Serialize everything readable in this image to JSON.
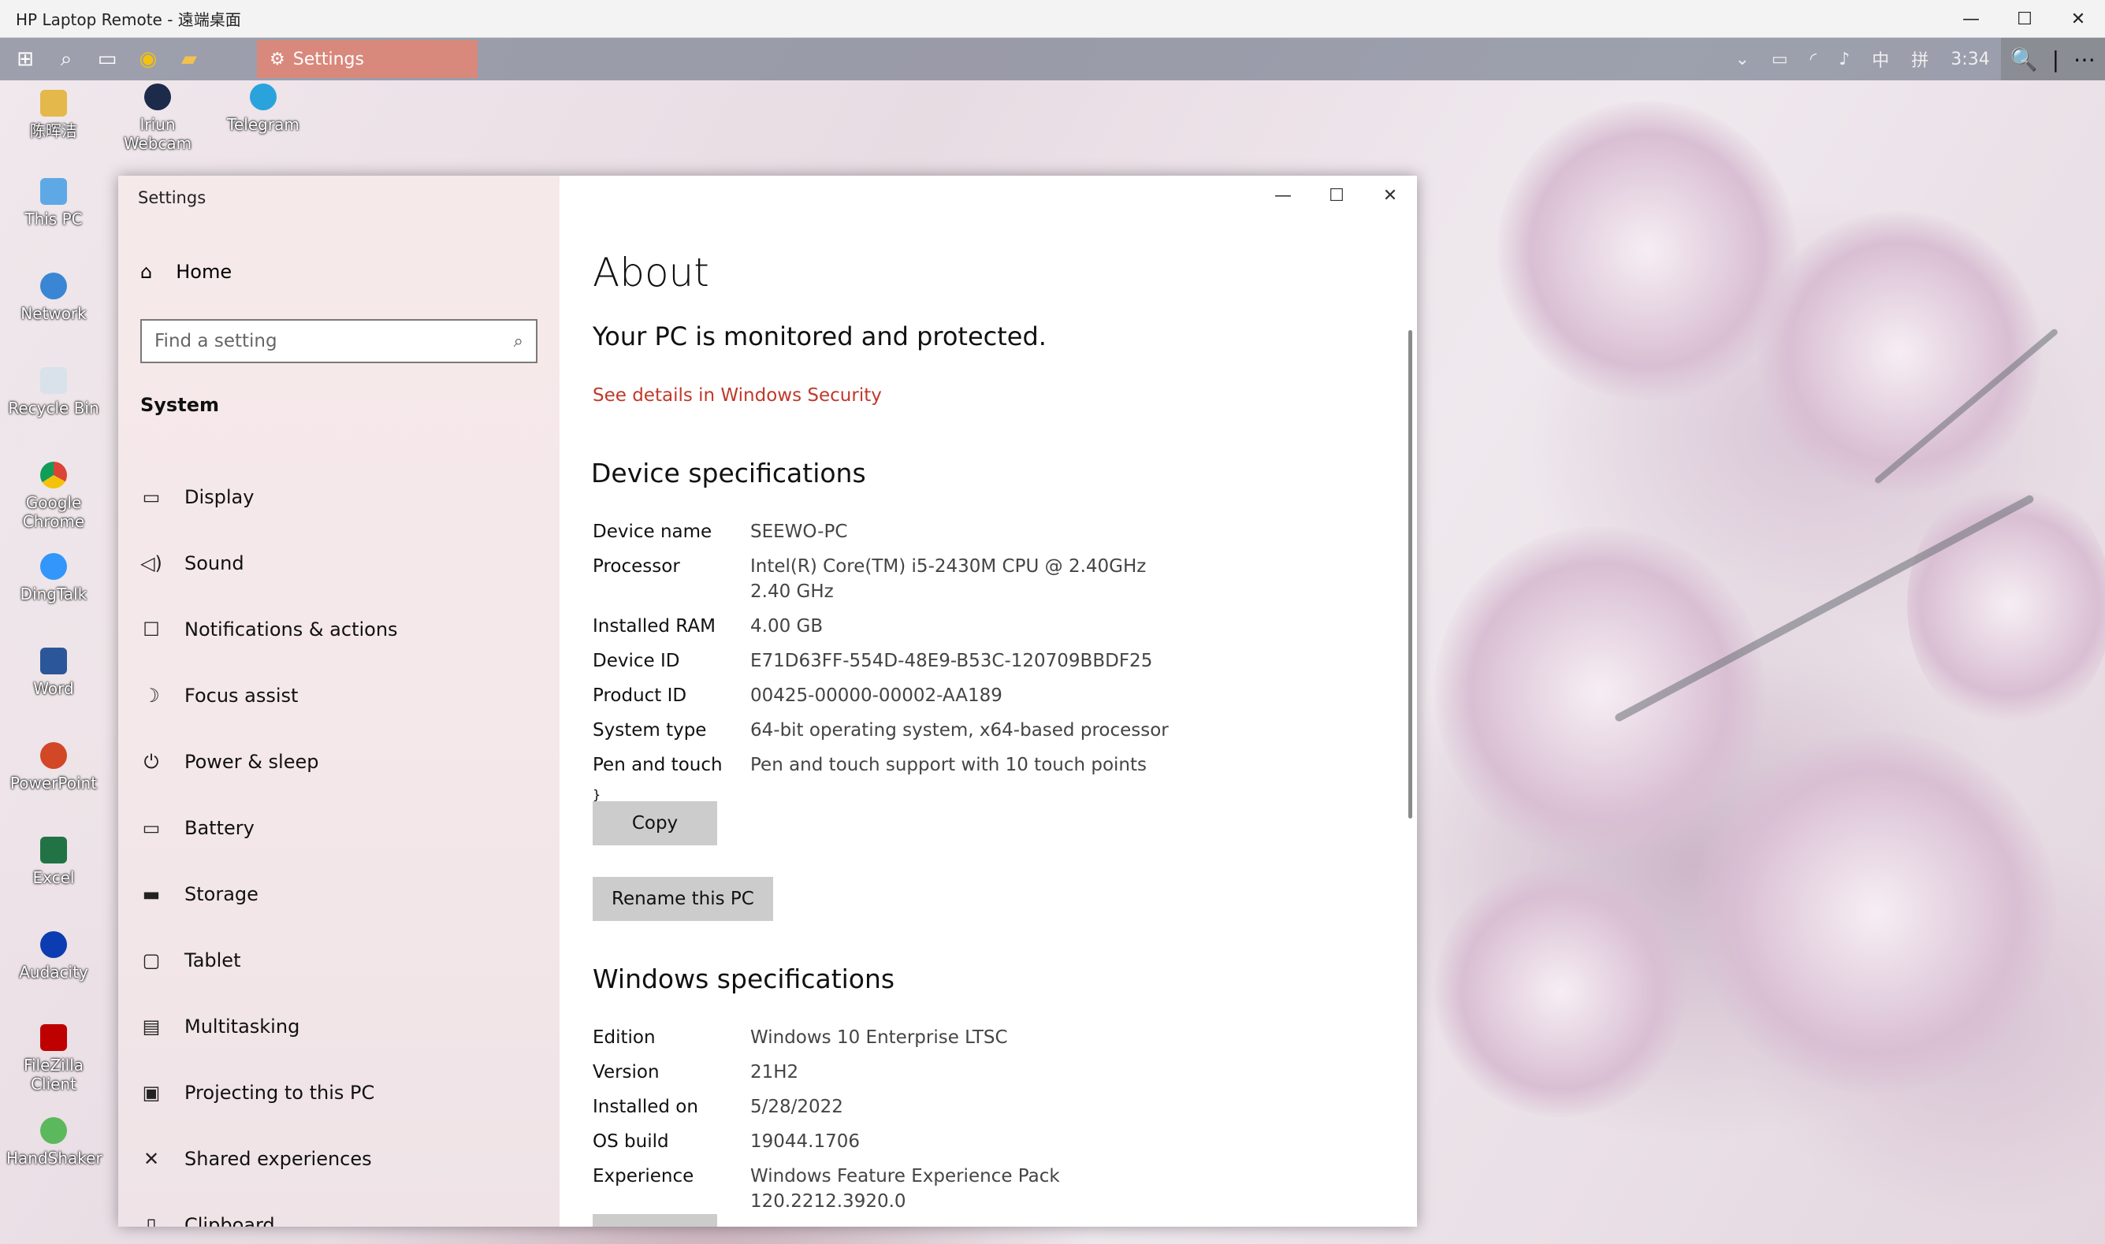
{
  "remote_window": {
    "title": "HP Laptop Remote - 遠端桌面",
    "minimize": "—",
    "maximize": "☐",
    "close": "✕"
  },
  "taskbar": {
    "settings_label": "Settings",
    "tray_ime": "中",
    "tray_ime2": "拼",
    "clock": "3:34",
    "zoom_icon": "🔍",
    "more": "⋯",
    "divider": "|"
  },
  "desktop_icons": [
    {
      "label": "陈晖洁"
    },
    {
      "label": "Iriun Webcam"
    },
    {
      "label": "Telegram"
    },
    {
      "label": "This PC"
    },
    {
      "label": "Network"
    },
    {
      "label": "Recycle Bin"
    },
    {
      "label": "Google Chrome"
    },
    {
      "label": "DingTalk"
    },
    {
      "label": "Word"
    },
    {
      "label": "PowerPoint"
    },
    {
      "label": "Excel"
    },
    {
      "label": "Audacity"
    },
    {
      "label": "FileZilla Client"
    },
    {
      "label": "HandShaker"
    }
  ],
  "settings": {
    "window_title": "Settings",
    "home_label": "Home",
    "search_placeholder": "Find a setting",
    "section_label": "System",
    "nav": [
      {
        "label": "Display",
        "icon": "display-icon"
      },
      {
        "label": "Sound",
        "icon": "sound-icon"
      },
      {
        "label": "Notifications & actions",
        "icon": "notifications-icon"
      },
      {
        "label": "Focus assist",
        "icon": "moon-icon"
      },
      {
        "label": "Power & sleep",
        "icon": "power-icon"
      },
      {
        "label": "Battery",
        "icon": "battery-icon"
      },
      {
        "label": "Storage",
        "icon": "storage-icon"
      },
      {
        "label": "Tablet",
        "icon": "tablet-icon"
      },
      {
        "label": "Multitasking",
        "icon": "multitasking-icon"
      },
      {
        "label": "Projecting to this PC",
        "icon": "projecting-icon"
      },
      {
        "label": "Shared experiences",
        "icon": "shared-icon"
      },
      {
        "label": "Clipboard",
        "icon": "clipboard-icon"
      }
    ],
    "about": {
      "title": "About",
      "protected": "Your PC is monitored and protected.",
      "security_link": "See details in Windows Security",
      "device_heading": "Device specifications",
      "device_specs": [
        {
          "key": "Device name",
          "value": "SEEWO-PC"
        },
        {
          "key": "Processor",
          "value": "Intel(R) Core(TM) i5-2430M CPU @ 2.40GHz   2.40 GHz"
        },
        {
          "key": "Installed RAM",
          "value": "4.00 GB"
        },
        {
          "key": "Device ID",
          "value": "E71D63FF-554D-48E9-B53C-120709BBDF25"
        },
        {
          "key": "Product ID",
          "value": "00425-00000-00002-AA189"
        },
        {
          "key": "System type",
          "value": "64-bit operating system, x64-based processor"
        },
        {
          "key": "Pen and touch",
          "value": "Pen and touch support with 10 touch points"
        }
      ],
      "copy_button": "Copy",
      "rename_button": "Rename this PC",
      "windows_heading": "Windows specifications",
      "windows_specs": [
        {
          "key": "Edition",
          "value": "Windows 10 Enterprise LTSC"
        },
        {
          "key": "Version",
          "value": "21H2"
        },
        {
          "key": "Installed on",
          "value": "5/28/2022"
        },
        {
          "key": "OS build",
          "value": "19044.1706"
        },
        {
          "key": "Experience",
          "value": "Windows Feature Experience Pack 120.2212.3920.0"
        }
      ]
    }
  },
  "colors": {
    "accent_link": "#c0392b",
    "taskbar_settings": "#d9887c",
    "button_bg": "#cccccc"
  }
}
